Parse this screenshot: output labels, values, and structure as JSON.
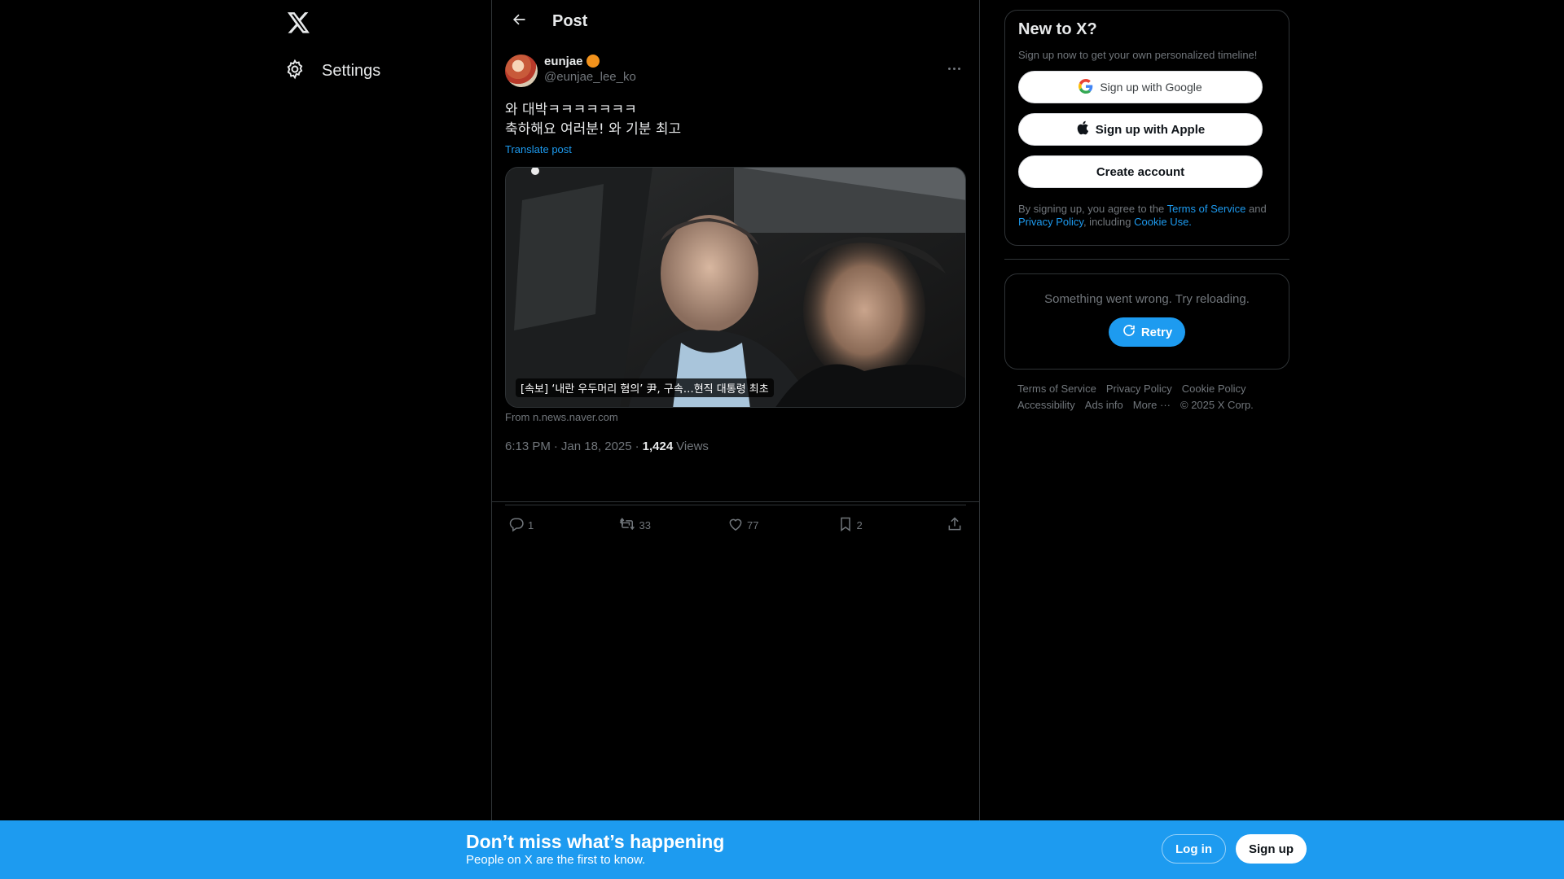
{
  "nav": {
    "logo_icon": "x-logo-icon",
    "settings_label": "Settings",
    "settings_icon": "gear-icon"
  },
  "header": {
    "back_icon": "arrow-left-icon",
    "title": "Post"
  },
  "tweet": {
    "display_name": "eunjae",
    "badge_color": "#f2921c",
    "handle": "@eunjae_lee_ko",
    "text_line1": "와 대박ㅋㅋㅋㅋㅋㅋㅋ",
    "text_line2": "축하해요 여러분! 와 기분 최고",
    "translate_label": "Translate post",
    "media_caption": "[속보] ‘내란 우두머리 혐의’ 尹, 구속…현직 대통령 최초",
    "media_source": "From n.news.naver.com",
    "time": "6:13 PM",
    "date": "Jan 18, 2025",
    "separator": "·",
    "views_count": "1,424",
    "views_label": "Views",
    "actions": {
      "replies": "1",
      "reposts": "33",
      "likes": "77",
      "bookmarks": "2"
    }
  },
  "signup": {
    "title": "New to X?",
    "subtitle": "Sign up now to get your own personalized timeline!",
    "google_label": "Sign up with Google",
    "apple_label": "Sign up with Apple",
    "create_label": "Create account",
    "legal_prefix": "By signing up, you agree to the ",
    "terms_link": "Terms of Service",
    "legal_and": " and ",
    "privacy_link": "Privacy Policy",
    "legal_including": ", including ",
    "cookie_link": "Cookie Use.",
    "link_color": "#1d9bf0"
  },
  "error": {
    "message": "Something went wrong. Try reloading.",
    "retry_label": "Retry"
  },
  "footer": {
    "terms": "Terms of Service",
    "privacy": "Privacy Policy",
    "cookie": "Cookie Policy",
    "accessibility": "Accessibility",
    "ads": "Ads info",
    "more": "More ···",
    "copyright": "© 2025 X Corp."
  },
  "banner": {
    "title": "Don’t miss what’s happening",
    "subtitle": "People on X are the first to know.",
    "login_label": "Log in",
    "signup_label": "Sign up",
    "color": "#1d9bf0"
  }
}
